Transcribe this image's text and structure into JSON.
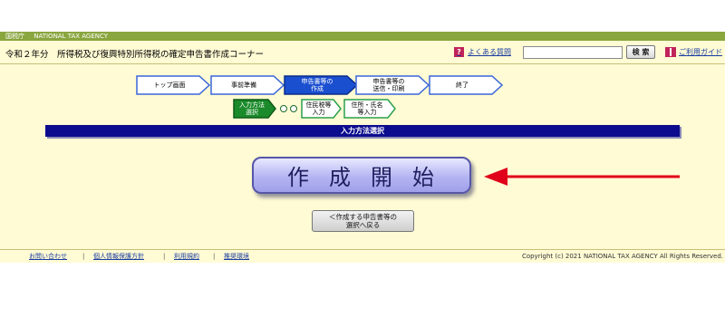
{
  "agency_bar": {
    "short": "国税庁",
    "english": "NATIONAL TAX AGENCY"
  },
  "header": {
    "title": "令和２年分　所得税及び復興特別所得税の確定申告書作成コーナー",
    "faq_label": "よくある質問",
    "search_value": "",
    "search_button": "検 索",
    "guide_label": "ご利用ガイド"
  },
  "steps": [
    {
      "label": "トップ画面",
      "state": "done"
    },
    {
      "label": "事前準備",
      "state": "done"
    },
    {
      "label": "申告書等の\n作成",
      "state": "active"
    },
    {
      "label": "申告書等の\n送信・印刷",
      "state": "todo"
    },
    {
      "label": "終了",
      "state": "todo"
    }
  ],
  "substeps": [
    {
      "label": "入力方法\n選択",
      "state": "active"
    },
    {
      "label": "住民税等\n入力",
      "state": "todo"
    },
    {
      "label": "住所・氏名\n等入力",
      "state": "todo"
    }
  ],
  "section_title": "入力方法選択",
  "start_button": "作成開始",
  "back_button": "＜作成する申告書等の\n選択へ戻る",
  "footer": {
    "links": [
      "お問い合わせ",
      "個人情報保護方針",
      "利用規約",
      "推奨環境"
    ],
    "copyright": "Copyright (c) 2021 NATIONAL TAX AGENCY All Rights Reserved."
  },
  "colors": {
    "agency_bar": "#8aa63f",
    "background": "#fffbd4",
    "section_bar": "#0c0c8e",
    "active_step": "#1a4fd0",
    "active_substep": "#1a8a2a",
    "arrow": "#e0001a"
  },
  "icons": {
    "faq": "question-mark-icon",
    "guide": "book-icon",
    "annotation": "red-arrow-left"
  }
}
